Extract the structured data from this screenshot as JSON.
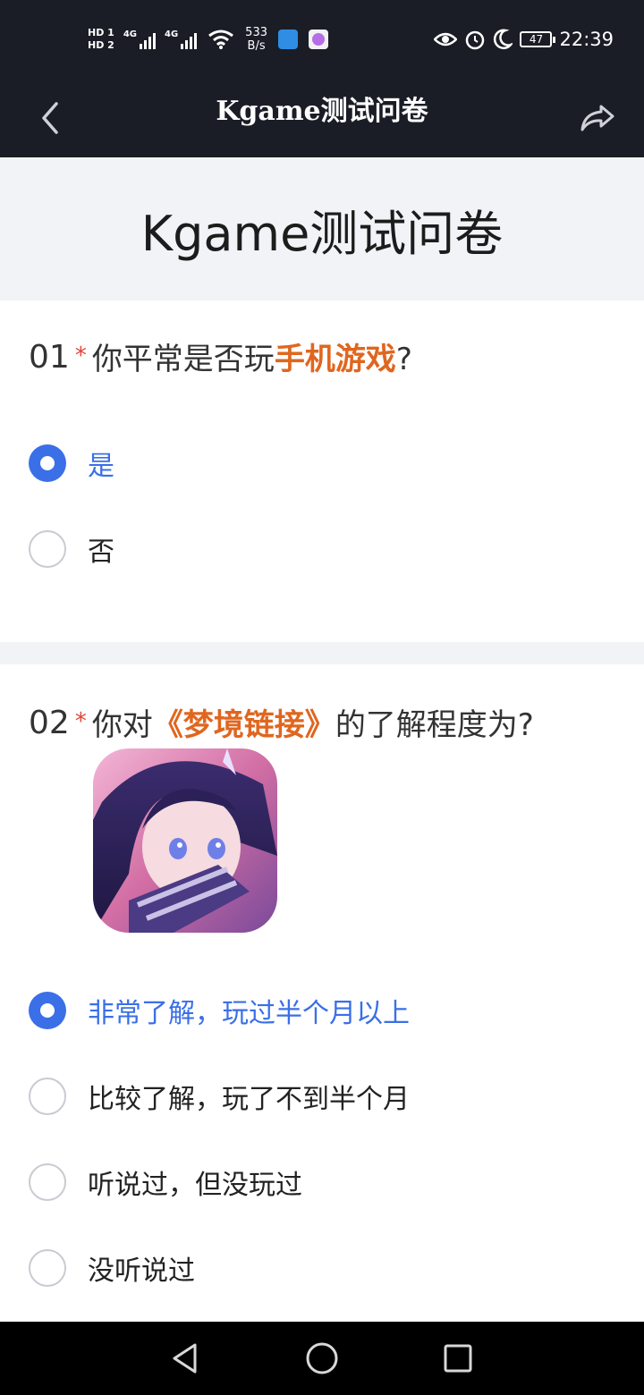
{
  "status_bar": {
    "hd1": "HD 1",
    "hd2": "HD 2",
    "net1": "4G",
    "net2": "4G",
    "speed_value": "533",
    "speed_unit": "B/s",
    "battery": "47",
    "time": "22:39"
  },
  "nav": {
    "title": "Kgame测试问卷"
  },
  "page": {
    "title": "Kgame测试问卷"
  },
  "q1": {
    "num": "01",
    "star": "*",
    "text_before": "你平常是否玩",
    "highlight": "手机游戏",
    "text_after": "?",
    "options": [
      "是",
      "否"
    ],
    "selected_index": 0
  },
  "q2": {
    "num": "02",
    "star": "*",
    "text_before": "你对",
    "highlight": "《梦境链接》",
    "text_after": "的了解程度为?",
    "options": [
      "非常了解，玩过半个月以上",
      "比较了解，玩了不到半个月",
      "听说过，但没玩过",
      "没听说过"
    ],
    "selected_index": 0
  },
  "colors": {
    "bar_bg": "#1a1d26",
    "accent": "#3a6fe8",
    "highlight": "#e0661f",
    "required": "#e0463a",
    "section_bg": "#f2f3f6"
  }
}
